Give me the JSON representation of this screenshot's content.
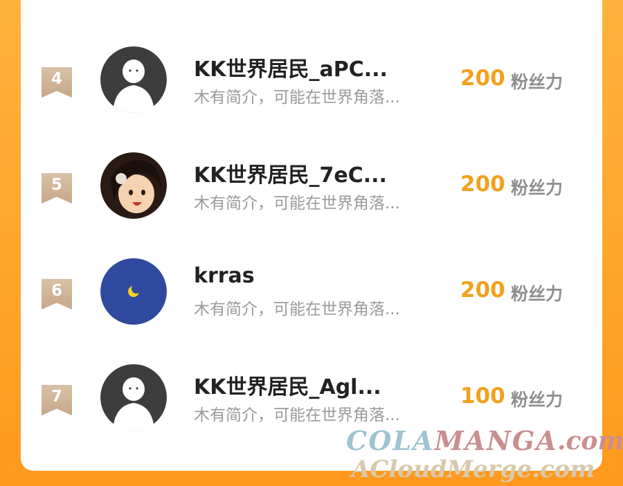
{
  "leaderboard": {
    "rows": [
      {
        "rank": "4",
        "name": "KK世界居民_aPC...",
        "bio": "木有简介，可能在世界角落...",
        "score": "200",
        "unit": "粉丝力",
        "avatar": "default-avatar"
      },
      {
        "rank": "5",
        "name": "KK世界居民_7eC...",
        "bio": "木有简介，可能在世界角落...",
        "score": "200",
        "unit": "粉丝力",
        "avatar": "anime-girl-avatar"
      },
      {
        "rank": "6",
        "name": "krras",
        "bio": "木有简介，可能在世界角落...",
        "score": "200",
        "unit": "粉丝力",
        "avatar": "moon-avatar"
      },
      {
        "rank": "7",
        "name": "KK世界居民_Agl...",
        "bio": "木有简介，可能在世界角落...",
        "score": "100",
        "unit": "粉丝力",
        "avatar": "default-avatar"
      }
    ]
  },
  "watermark": {
    "cola": "COLA",
    "manga": "MANGA",
    "com": ".com",
    "line2": "ACloudMerge.com"
  },
  "colors": {
    "background": "#ff9a1e",
    "score": "#f2a11d",
    "rank_badge": "#c6a78a",
    "moon_avatar_bg": "#2f4a9e",
    "moon": "#f3d423"
  }
}
